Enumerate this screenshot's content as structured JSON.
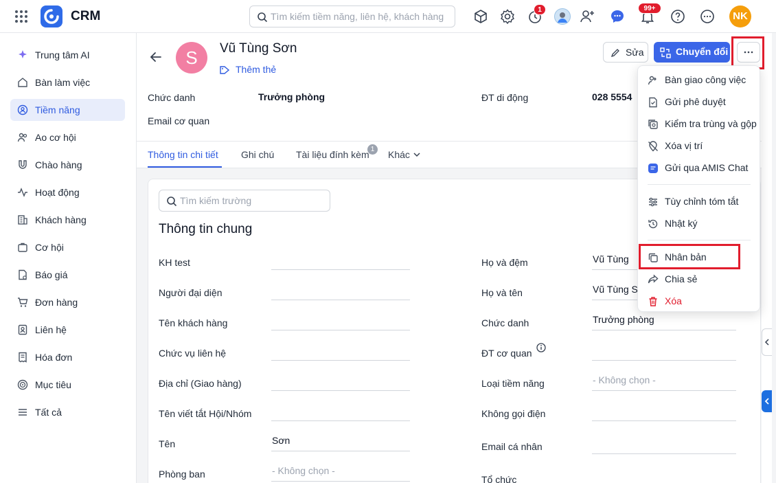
{
  "app": {
    "brand": "CRM",
    "search_placeholder": "Tìm kiếm tiềm năng, liên hệ, khách hàng",
    "badges": {
      "timer": "1",
      "notifications": "99+"
    },
    "user_initials": "NK"
  },
  "sidebar": {
    "items": [
      {
        "label": "Trung tâm AI",
        "icon": "sparkle-icon"
      },
      {
        "label": "Bàn làm việc",
        "icon": "home-icon"
      },
      {
        "label": "Tiềm năng",
        "icon": "lead-icon",
        "active": true
      },
      {
        "label": "Ao cơ hội",
        "icon": "users-icon"
      },
      {
        "label": "Chào hàng",
        "icon": "magnet-icon"
      },
      {
        "label": "Hoạt động",
        "icon": "activity-icon"
      },
      {
        "label": "Khách hàng",
        "icon": "building-icon"
      },
      {
        "label": "Cơ hội",
        "icon": "briefcase-icon"
      },
      {
        "label": "Báo giá",
        "icon": "quote-icon"
      },
      {
        "label": "Đơn hàng",
        "icon": "cart-icon"
      },
      {
        "label": "Liên hệ",
        "icon": "contact-icon"
      },
      {
        "label": "Hóa đơn",
        "icon": "invoice-icon"
      },
      {
        "label": "Mục tiêu",
        "icon": "target-icon"
      },
      {
        "label": "Tất cả",
        "icon": "menu-icon"
      }
    ]
  },
  "record": {
    "avatar_letter": "S",
    "name": "Vũ Tùng Sơn",
    "add_tag": "Thêm thẻ",
    "edit_label": "Sửa",
    "convert_label": "Chuyển đổi",
    "summary": {
      "title_label": "Chức danh",
      "title_value": "Trưởng phòng",
      "mobile_label": "ĐT di động",
      "mobile_value": "028 5554",
      "email_label": "Email cơ quan"
    }
  },
  "tabs": [
    {
      "label": "Thông tin chi tiết",
      "active": true
    },
    {
      "label": "Ghi chú"
    },
    {
      "label": "Tài liệu đính kèm",
      "badge": "1"
    },
    {
      "label": "Khác"
    }
  ],
  "details": {
    "field_search_placeholder": "Tìm kiếm trường",
    "section_title": "Thông tin chung",
    "left_fields": [
      {
        "label": "KH test",
        "value": ""
      },
      {
        "label": "Người đại diện",
        "value": ""
      },
      {
        "label": "Tên khách hàng",
        "value": ""
      },
      {
        "label": "Chức vụ liên hệ",
        "value": ""
      },
      {
        "label": "Địa chỉ (Giao hàng)",
        "value": ""
      },
      {
        "label": "Tên viết tắt Hội/Nhóm",
        "value": ""
      },
      {
        "label": "Tên",
        "value": "Sơn"
      },
      {
        "label": "Phòng ban",
        "placeholder": "- Không chọn -"
      }
    ],
    "right_fields": [
      {
        "label": "Họ và đệm",
        "value": "Vũ Tùng"
      },
      {
        "label": "Họ và tên",
        "value": "Vũ Tùng S"
      },
      {
        "label": "Chức danh",
        "value": "Trưởng phòng"
      },
      {
        "label": "ĐT cơ quan",
        "value": ""
      },
      {
        "label": "Loại tiềm năng",
        "placeholder": "- Không chọn -"
      },
      {
        "label": "Không gọi điện",
        "value": ""
      },
      {
        "label": "Email cá nhân",
        "value": ""
      },
      {
        "label": "Tổ chức",
        "value": ""
      }
    ]
  },
  "menu": {
    "items": [
      {
        "label": "Bàn giao công việc",
        "icon": "handover-icon"
      },
      {
        "label": "Gửi phê duyệt",
        "icon": "approval-icon"
      },
      {
        "label": "Kiểm tra trùng và gộp",
        "icon": "duplicate-check-icon"
      },
      {
        "label": "Xóa vị trí",
        "icon": "location-off-icon"
      },
      {
        "label": "Gửi qua AMIS Chat",
        "icon": "chat-icon"
      },
      {
        "label": "Tùy chỉnh tóm tắt",
        "icon": "sliders-icon"
      },
      {
        "label": "Nhật ký",
        "icon": "history-icon"
      },
      {
        "label": "Nhân bản",
        "icon": "copy-icon"
      },
      {
        "label": "Chia sẻ",
        "icon": "share-icon"
      },
      {
        "label": "Xóa",
        "icon": "trash-icon",
        "danger": true
      }
    ]
  },
  "colors": {
    "accent": "#3b66e8",
    "highlight": "#e11d2d",
    "avatar": "#f27fa3"
  }
}
